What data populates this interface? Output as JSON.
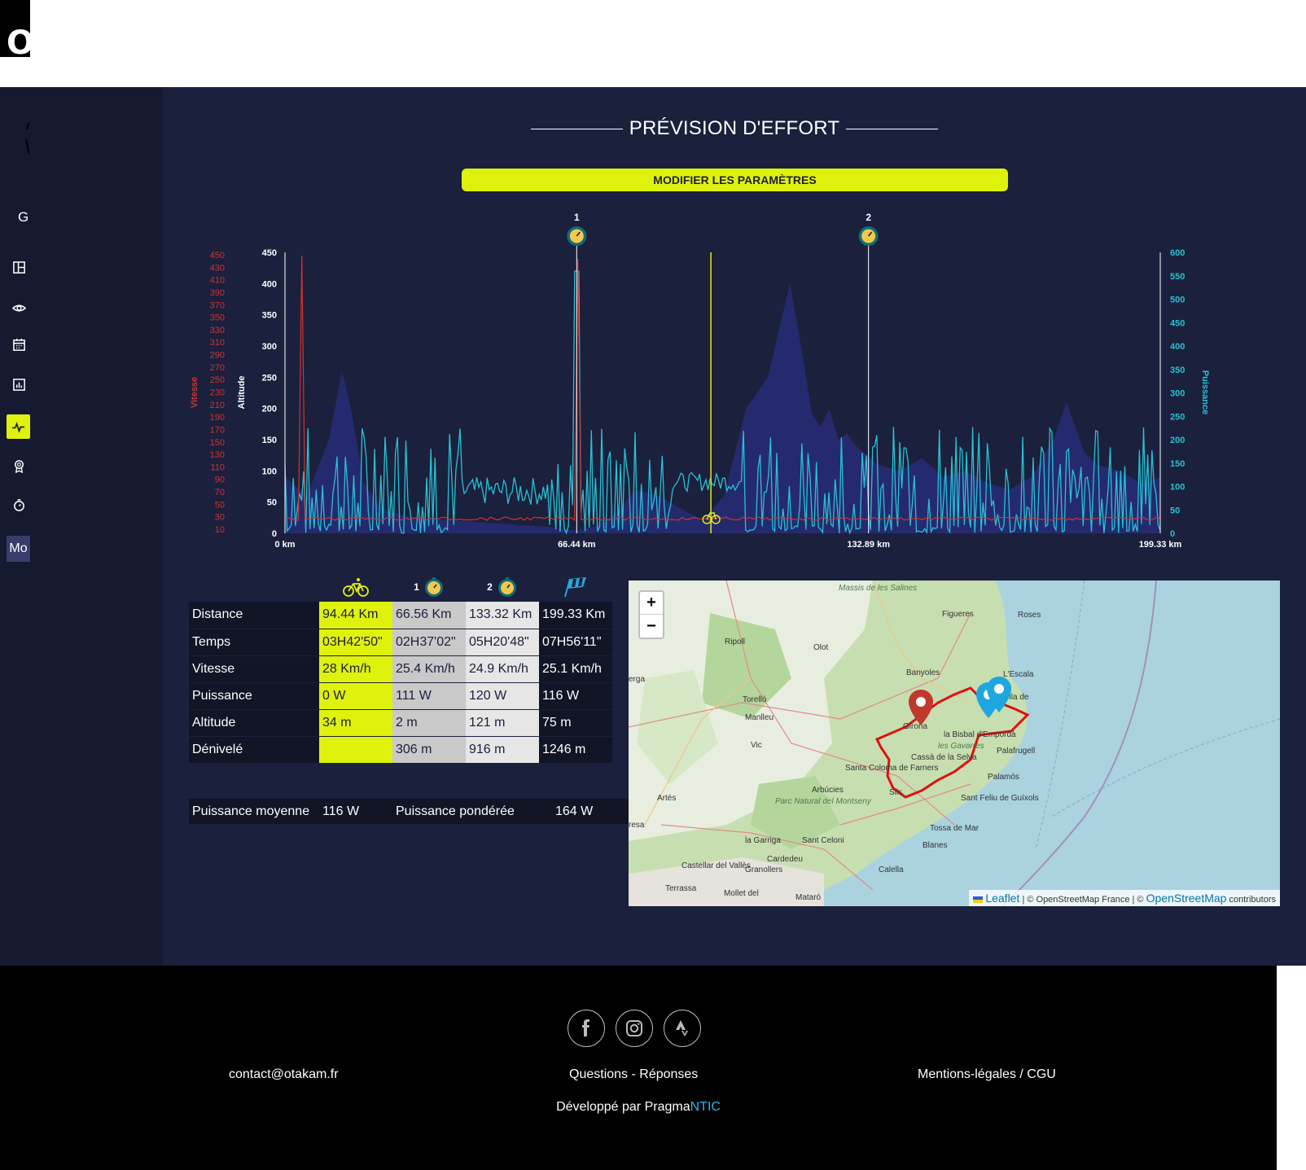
{
  "topbar": {
    "logo_letter": "O"
  },
  "sidebar": {
    "letter": "G",
    "mo_label": "Mo",
    "items": [
      {
        "icon": "dashboard-icon"
      },
      {
        "icon": "eye-icon"
      },
      {
        "icon": "calendar-icon"
      },
      {
        "icon": "chart-icon"
      },
      {
        "icon": "activity-icon",
        "active": true
      },
      {
        "icon": "medal-icon"
      },
      {
        "icon": "stopwatch-icon"
      }
    ]
  },
  "page": {
    "title": "PRÉVISION D'EFFORT",
    "params_button": "MODIFIER LES PARAMÈTRES"
  },
  "chart_data": {
    "type": "line",
    "xlabel_ticks": [
      "0 km",
      "66.44 km",
      "132.89 km",
      "199.33 km"
    ],
    "x_range": [
      0,
      199.33
    ],
    "axes": {
      "vitesse": {
        "label": "Vitesse",
        "ticks": [
          10,
          30,
          50,
          70,
          90,
          110,
          130,
          150,
          170,
          190,
          210,
          230,
          250,
          270,
          290,
          310,
          330,
          350,
          370,
          390,
          410,
          430,
          450
        ],
        "color": "#d0342c"
      },
      "altitude": {
        "label": "Altitude",
        "ticks": [
          0,
          50,
          100,
          150,
          200,
          250,
          300,
          350,
          400,
          450
        ],
        "range": [
          0,
          450
        ]
      },
      "puissance": {
        "label": "Puissance",
        "ticks": [
          0,
          50,
          100,
          150,
          200,
          250,
          300,
          350,
          400,
          450,
          500,
          550,
          600
        ],
        "range": [
          0,
          600
        ],
        "color": "#29c1d3"
      }
    },
    "checkpoints": [
      {
        "label": "1",
        "km": 66.44
      },
      {
        "label": "2",
        "km": 132.89
      }
    ],
    "current_km": 97.0,
    "altitude_profile": {
      "km": [
        0,
        5,
        10,
        13,
        15,
        18,
        22,
        26,
        30,
        40,
        50,
        60,
        66,
        70,
        75,
        80,
        85,
        90,
        95,
        100,
        105,
        110,
        112,
        115,
        118,
        120,
        122,
        124,
        126,
        128,
        130,
        135,
        140,
        145,
        150,
        155,
        160,
        165,
        170,
        175,
        178,
        180,
        182,
        185,
        190,
        195,
        199.33
      ],
      "m": [
        90,
        60,
        150,
        260,
        200,
        80,
        40,
        30,
        25,
        20,
        15,
        10,
        5,
        10,
        30,
        70,
        60,
        40,
        20,
        60,
        200,
        250,
        310,
        400,
        280,
        190,
        170,
        200,
        150,
        160,
        140,
        110,
        100,
        120,
        90,
        100,
        80,
        70,
        90,
        150,
        210,
        170,
        130,
        110,
        100,
        80,
        90
      ]
    },
    "series": [
      {
        "name": "Vitesse",
        "color": "#d0342c"
      },
      {
        "name": "Altitude",
        "color": "#262b72"
      },
      {
        "name": "Puissance",
        "color": "#29c1d3"
      }
    ]
  },
  "table": {
    "headers": [
      {
        "icon": "bike-icon",
        "label": ""
      },
      {
        "icon": "stopwatch-icon",
        "label": "1"
      },
      {
        "icon": "stopwatch-icon",
        "label": "2"
      },
      {
        "icon": "finish-flag-icon",
        "label": ""
      }
    ],
    "rows": [
      {
        "label": "Distance",
        "values": [
          "94.44 Km",
          "66.56 Km",
          "133.32 Km",
          "199.33 Km"
        ]
      },
      {
        "label": "Temps",
        "values": [
          "03H42'50\"",
          "02H37'02\"",
          "05H20'48\"",
          "07H56'11\""
        ]
      },
      {
        "label": "Vitesse",
        "values": [
          "28 Km/h",
          "25.4 Km/h",
          "24.9 Km/h",
          "25.1 Km/h"
        ]
      },
      {
        "label": "Puissance",
        "values": [
          "0 W",
          "111 W",
          "120 W",
          "116 W"
        ]
      },
      {
        "label": "Altitude",
        "values": [
          "34 m",
          "2 m",
          "121 m",
          "75 m"
        ]
      },
      {
        "label": "Dénivelé",
        "values": [
          "",
          "306 m",
          "916 m",
          "1246 m"
        ]
      }
    ]
  },
  "averages": {
    "avg_label": "Puissance moyenne",
    "avg_value": "116 W",
    "weighted_label": "Puissance pondérée",
    "weighted_value": "164 W"
  },
  "map": {
    "zoom_in": "+",
    "zoom_out": "−",
    "attribution_leaflet": "Leaflet",
    "attribution_mid": "| © OpenStreetMap France | ©",
    "attribution_osm": "OpenStreetMap",
    "attribution_end": "contributors",
    "places": [
      "Massis de les Salines",
      "Figueres",
      "Roses",
      "Ripoll",
      "Olot",
      "Banyoles",
      "L'Escala",
      "erga",
      "Torelló",
      "Manlleu",
      "Girona",
      "la Bisbal d'Empordà",
      "les Gavarres",
      "Cassà de la Selva",
      "Palafrugell",
      "Vic",
      "Santa Coloma de Farners",
      "Arbúcies",
      "Palamós",
      "Sils",
      "Sant Feliu de Guíxols",
      "Artés",
      "Parc Natural del Montseny",
      "resa",
      "Tossa de Mar",
      "la Garriga",
      "Sant Celoni",
      "Blanes",
      "Cardedeu",
      "Castellar del Vallès",
      "Granollers",
      "Calella",
      "Terrassa",
      "Mollet del",
      "Mataró",
      "ella de"
    ]
  },
  "footer": {
    "email": "contact@otakam.fr",
    "faq": "Questions - Réponses",
    "legal": "Mentions-légales / CGU",
    "dev_prefix": "Développé par Pragma",
    "dev_accent": "NTIC"
  }
}
